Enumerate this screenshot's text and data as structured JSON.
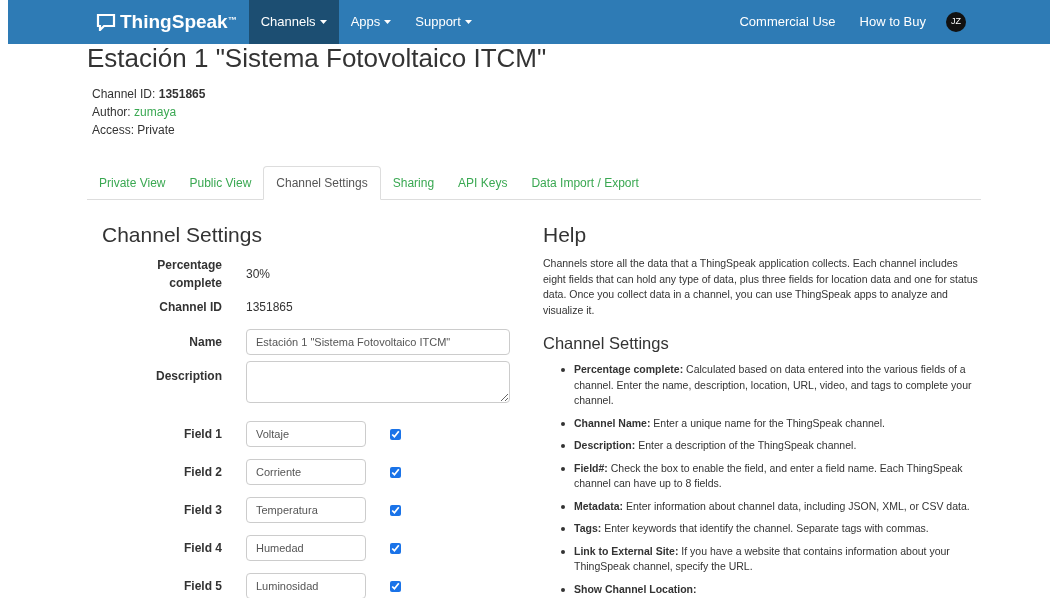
{
  "navbar": {
    "logo": "ThingSpeak",
    "logo_mark": "™",
    "menus": [
      {
        "label": "Channels",
        "selected": true
      },
      {
        "label": "Apps",
        "selected": false
      },
      {
        "label": "Support",
        "selected": false
      }
    ],
    "right_links": [
      "Commercial Use",
      "How to Buy"
    ],
    "avatar": "JZ"
  },
  "title": "Estación 1 \"Sistema Fotovoltaico ITCM\"",
  "meta": [
    {
      "label": "Channel ID:",
      "value": "1351865",
      "kind": "bold"
    },
    {
      "label": "Author:",
      "value": "zumaya",
      "kind": "link"
    },
    {
      "label": "Access:",
      "value": "Private",
      "kind": "plain"
    }
  ],
  "tabs": [
    {
      "label": "Private View",
      "selected": false
    },
    {
      "label": "Public View",
      "selected": false
    },
    {
      "label": "Channel Settings",
      "selected": true
    },
    {
      "label": "Sharing",
      "selected": false
    },
    {
      "label": "API Keys",
      "selected": false
    },
    {
      "label": "Data Import / Export",
      "selected": false
    }
  ],
  "settings": {
    "heading": "Channel Settings",
    "rows": [
      {
        "kind": "text",
        "label": "Percentage complete",
        "value": "30%"
      },
      {
        "kind": "text",
        "label": "Channel ID",
        "value": "1351865"
      },
      {
        "kind": "input",
        "label": "Name",
        "value": "Estación 1 \"Sistema Fotovoltaico ITCM\""
      },
      {
        "kind": "textarea",
        "label": "Description"
      },
      {
        "kind": "field",
        "label": "Field 1",
        "value": "Voltaje",
        "checked": true
      },
      {
        "kind": "field",
        "label": "Field 2",
        "value": "Corriente",
        "checked": true
      },
      {
        "kind": "field",
        "label": "Field 3",
        "value": "Temperatura",
        "checked": true
      },
      {
        "kind": "field",
        "label": "Field 4",
        "value": "Humedad",
        "checked": true
      },
      {
        "kind": "field",
        "label": "Field 5",
        "value": "Luminosidad",
        "checked": true
      }
    ]
  },
  "help": {
    "heading": "Help",
    "intro": "Channels store all the data that a ThingSpeak application collects. Each channel includes eight fields that can hold any type of data, plus three fields for location data and one for status data. Once you collect data in a channel, you can use ThingSpeak apps to analyze and visualize it.",
    "subheading": "Channel Settings",
    "items": [
      "**Percentage complete:** Calculated based on data entered into the various fields of a channel. Enter the name, description, location, URL, video, and tags to complete your channel.",
      "**Channel Name:** Enter a unique name for the ThingSpeak channel.",
      "**Description:** Enter a description of the ThingSpeak channel.",
      "**Field#:** Check the box to enable the field, and enter a field name. Each ThingSpeak channel can have up to 8 fields.",
      "**Metadata:** Enter information about channel data, including JSON, XML, or CSV data.",
      "**Tags:** Enter keywords that identify the channel. Separate tags with commas.",
      "**Link to External Site:** If you have a website that contains information about your ThingSpeak channel, specify the URL.",
      "**Show Channel Location:**"
    ]
  }
}
